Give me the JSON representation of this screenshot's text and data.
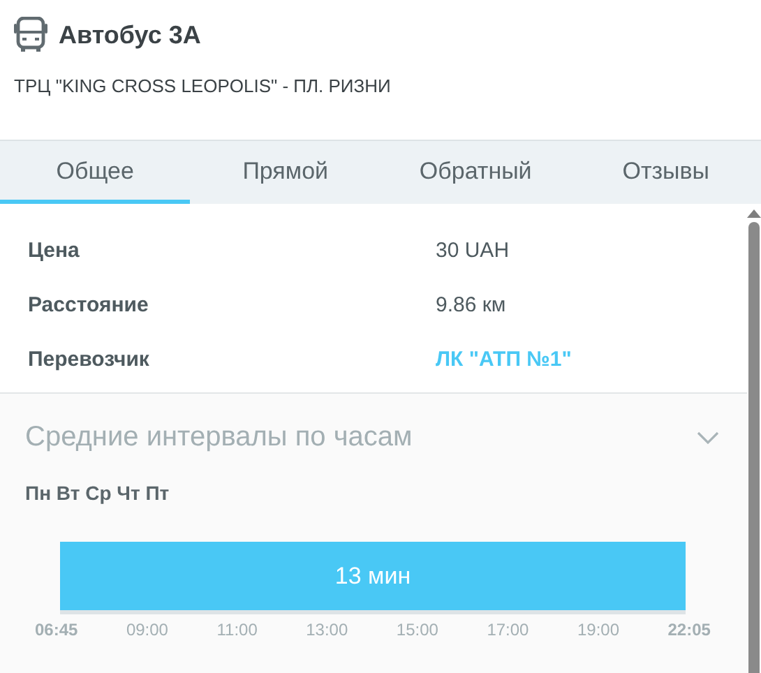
{
  "header": {
    "title": "Автобус 3А",
    "route": "ТРЦ \"KING CROSS LEOPOLIS\" - ПЛ. РИЗНИ"
  },
  "tabs": [
    {
      "label": "Общее",
      "selected": true
    },
    {
      "label": "Прямой",
      "selected": false
    },
    {
      "label": "Обратный",
      "selected": false
    },
    {
      "label": "Отзывы",
      "selected": false
    }
  ],
  "info": [
    {
      "label": "Цена",
      "value": "30 UAH",
      "kind": "text"
    },
    {
      "label": "Расстояние",
      "value": "9.86 км",
      "kind": "text"
    },
    {
      "label": "Перевозчик",
      "value": "ЛК \"АТП №1\"",
      "kind": "link"
    }
  ],
  "intervals": {
    "title": "Средние интервалы по часам",
    "expanded": true,
    "days": "Пн Вт Ср Чт Пт",
    "segments": [
      {
        "label": "13 мин"
      }
    ],
    "axis_labels": [
      {
        "text": "06:45",
        "kind": "end"
      },
      {
        "text": "09:00",
        "kind": "tick"
      },
      {
        "text": "11:00",
        "kind": "tick"
      },
      {
        "text": "13:00",
        "kind": "tick"
      },
      {
        "text": "15:00",
        "kind": "tick"
      },
      {
        "text": "17:00",
        "kind": "tick"
      },
      {
        "text": "19:00",
        "kind": "tick"
      },
      {
        "text": "22:05",
        "kind": "end"
      }
    ]
  }
}
